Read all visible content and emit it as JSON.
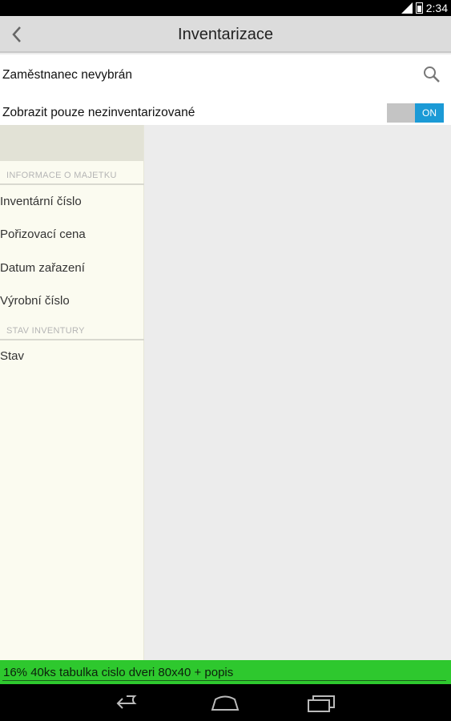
{
  "status_bar": {
    "time": "2:34",
    "icons": [
      "signal-icon",
      "battery-icon"
    ]
  },
  "action_bar": {
    "title": "Inventarizace",
    "back_icon": "chevron-left-icon"
  },
  "employee_row": {
    "label": "Zaměstnanec nevybrán",
    "icon": "search-icon"
  },
  "filter_row": {
    "label": "Zobrazit pouze nezinventarizované",
    "toggle_state": "ON"
  },
  "panel": {
    "sections": [
      {
        "header": "INFORMACE O MAJETKU",
        "items": [
          "Inventární číslo",
          "Pořizovací cena",
          "Datum zařazení",
          "Výrobní číslo"
        ]
      },
      {
        "header": "STAV INVENTURY",
        "items": [
          "Stav"
        ]
      }
    ]
  },
  "green_bar": {
    "text": "16% 40ks tabulka cislo dveri 80x40 + popis"
  },
  "nav_bar": {
    "buttons": [
      "back-icon",
      "home-icon",
      "recents-icon"
    ]
  },
  "colors": {
    "toggle_on": "#1b9ad6",
    "green_bar": "#2ec82e",
    "panel_bg": "#fbfbf0"
  }
}
